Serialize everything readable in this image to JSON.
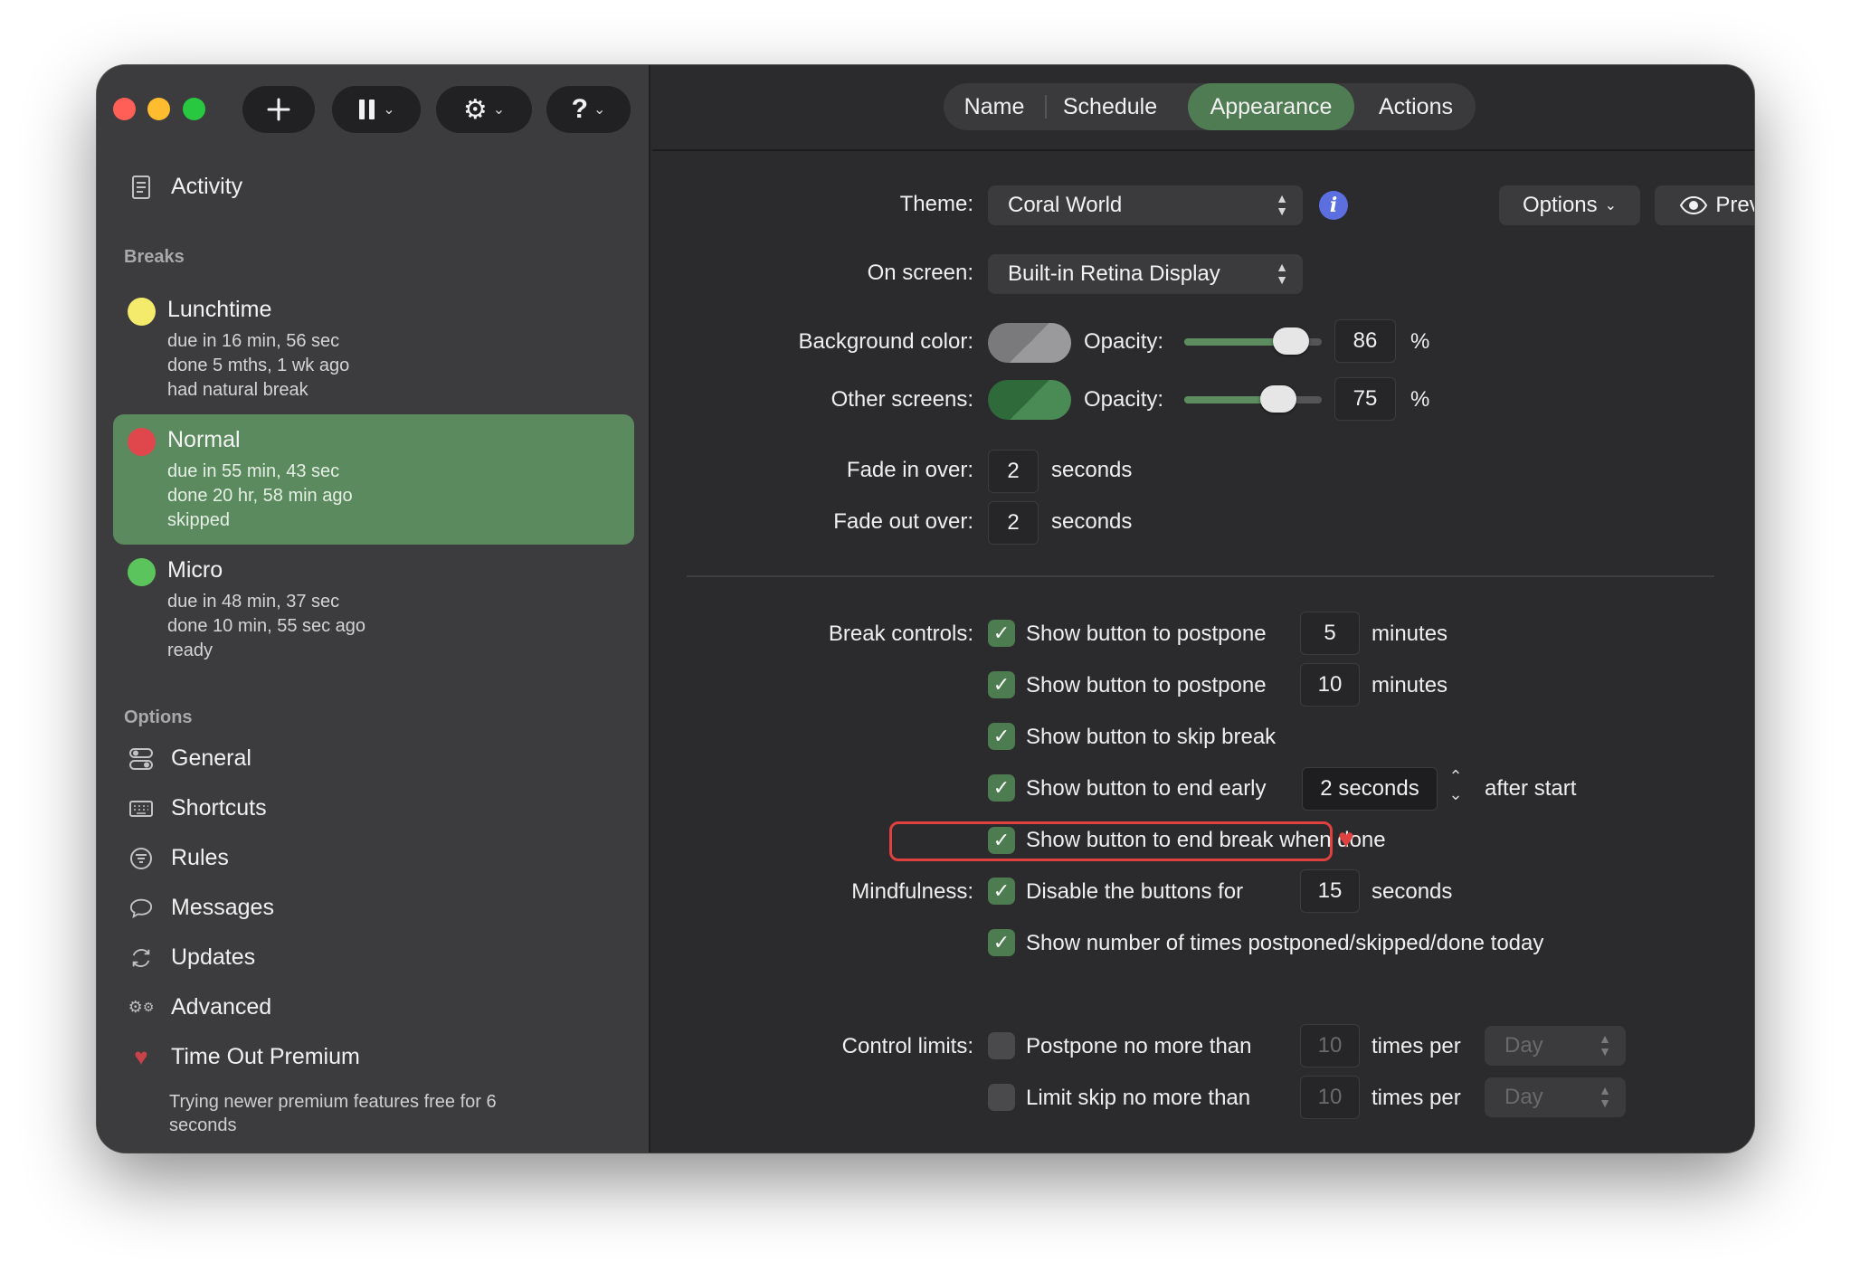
{
  "toolbar": {
    "add_icon": "plus-icon",
    "pause_icon": "pause-icon",
    "gear_icon": "gear-icon",
    "help_label": "?"
  },
  "sidebar": {
    "activity_label": "Activity",
    "breaks_heading": "Breaks",
    "breaks": [
      {
        "name": "Lunchtime",
        "color": "#f4ea6c",
        "due": "due in 16 min, 56 sec",
        "done": "done 5 mths, 1 wk ago",
        "status": "had natural break"
      },
      {
        "name": "Normal",
        "color": "#e0474c",
        "due": "due in 55 min, 43 sec",
        "done": "done 20 hr, 58 min ago",
        "status": "skipped"
      },
      {
        "name": "Micro",
        "color": "#5cc45c",
        "due": "due in 48 min, 37 sec",
        "done": "done 10 min, 55 sec ago",
        "status": "ready"
      }
    ],
    "options_heading": "Options",
    "options": [
      {
        "label": "General",
        "icon": "toggles-icon"
      },
      {
        "label": "Shortcuts",
        "icon": "keyboard-icon"
      },
      {
        "label": "Rules",
        "icon": "rules-icon"
      },
      {
        "label": "Messages",
        "icon": "message-bubble-icon"
      },
      {
        "label": "Updates",
        "icon": "refresh-icon"
      },
      {
        "label": "Advanced",
        "icon": "gears-icon"
      }
    ],
    "premium_label": "Time Out Premium",
    "premium_sub": "Trying newer premium features free for 6 seconds"
  },
  "tabs": [
    "Name",
    "Schedule",
    "Appearance",
    "Actions"
  ],
  "active_tab": "Appearance",
  "appearance": {
    "theme_label": "Theme:",
    "theme_value": "Coral World",
    "options_button": "Options",
    "preview_button": "Preview",
    "on_screen_label": "On screen:",
    "on_screen_value": "Built-in Retina Display",
    "bg_color_label": "Background color:",
    "opacity_label": "Opacity:",
    "bg_opacity": "86",
    "other_screens_label": "Other screens:",
    "other_opacity": "75",
    "percent": "%",
    "fade_in_label": "Fade in over:",
    "fade_in_value": "2",
    "fade_out_label": "Fade out over:",
    "fade_out_value": "2",
    "seconds": "seconds",
    "break_controls_label": "Break controls:",
    "postpone1_label": "Show button to postpone",
    "postpone1_value": "5",
    "postpone2_label": "Show button to postpone",
    "postpone2_value": "10",
    "minutes": "minutes",
    "skip_label": "Show button to skip break",
    "end_early_label": "Show button to end early",
    "end_early_value": "2 seconds",
    "after_start": "after start",
    "end_done_label": "Show button to end break when done",
    "mindfulness_label": "Mindfulness:",
    "disable_label": "Disable the buttons for",
    "disable_value": "15",
    "show_count_label": "Show number of times postponed/skipped/done today",
    "control_limits_label": "Control limits:",
    "postpone_limit_label": "Postpone no more than",
    "postpone_limit_value": "10",
    "skip_limit_label": "Limit skip no more than",
    "skip_limit_value": "10",
    "times_per": "times per",
    "period_value": "Day",
    "accent_color": "#4f7c53",
    "highlight_color": "#e0403e"
  }
}
